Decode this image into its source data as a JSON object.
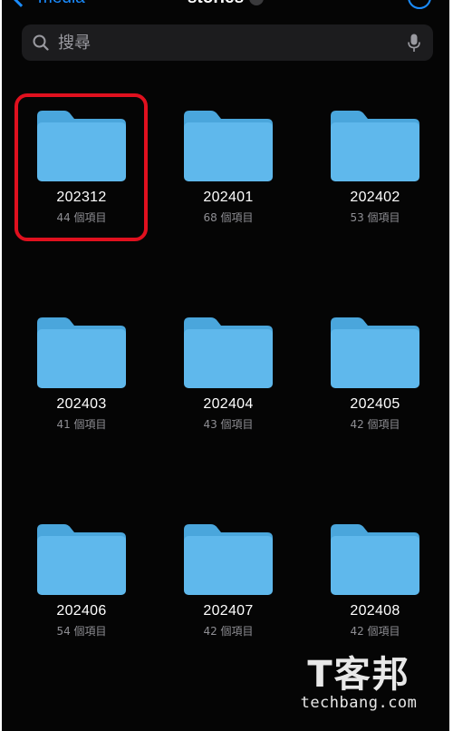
{
  "nav": {
    "back_label": "media",
    "title": "stories"
  },
  "search": {
    "placeholder": "搜尋"
  },
  "folders": [
    {
      "name": "202312",
      "count": "44 個項目"
    },
    {
      "name": "202401",
      "count": "68 個項目"
    },
    {
      "name": "202402",
      "count": "53 個項目"
    },
    {
      "name": "202403",
      "count": "41 個項目"
    },
    {
      "name": "202404",
      "count": "43 個項目"
    },
    {
      "name": "202405",
      "count": "42 個項目"
    },
    {
      "name": "202406",
      "count": "54 個項目"
    },
    {
      "name": "202407",
      "count": "42 個項目"
    },
    {
      "name": "202408",
      "count": "42 個項目"
    }
  ],
  "highlighted_folder": "202312",
  "watermark": {
    "chars": "T客邦",
    "domain": "techbang.com"
  },
  "colors": {
    "background": "#050505",
    "folder_blue": "#5fb8ec",
    "highlight_red": "#e0101e",
    "accent_blue": "#1a8cff"
  },
  "icons": {
    "search": "search-icon",
    "mic": "mic-icon",
    "folder": "folder-icon",
    "back": "chevron-left-icon",
    "more": "more-circle-icon"
  }
}
